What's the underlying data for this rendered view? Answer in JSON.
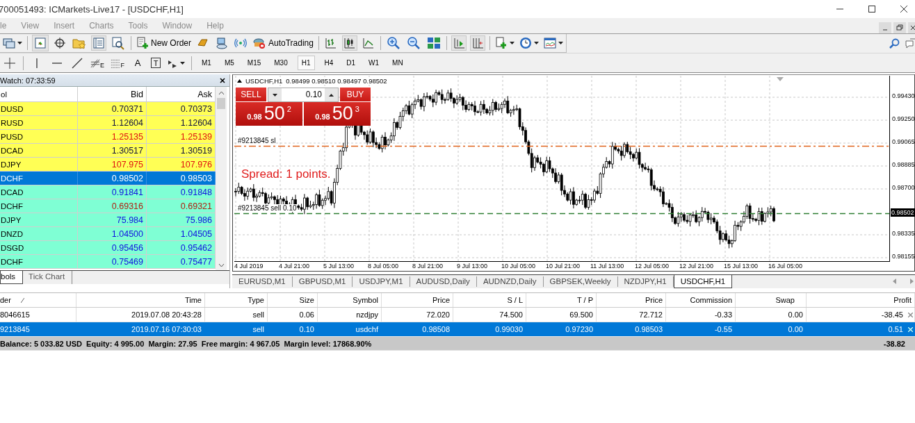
{
  "window": {
    "title": "700051493: ICMarkets-Live17 - [USDCHF,H1]"
  },
  "menu": [
    "le",
    "View",
    "Insert",
    "Charts",
    "Tools",
    "Window",
    "Help"
  ],
  "toolbar": {
    "new_order": "New Order",
    "autotrading": "AutoTrading"
  },
  "drawing_toolbar": {
    "fibo_labels": [
      "E",
      "F"
    ],
    "text_labels": [
      "A",
      "T"
    ]
  },
  "timeframes": [
    {
      "label": "M1",
      "selected": false
    },
    {
      "label": "M5",
      "selected": false
    },
    {
      "label": "M15",
      "selected": false
    },
    {
      "label": "M30",
      "selected": false
    },
    {
      "label": "H1",
      "selected": true
    },
    {
      "label": "H4",
      "selected": false
    },
    {
      "label": "D1",
      "selected": false
    },
    {
      "label": "W1",
      "selected": false
    },
    {
      "label": "MN",
      "selected": false
    }
  ],
  "market_watch": {
    "title": "Watch: 07:33:59",
    "columns": [
      "ol",
      "Bid",
      "Ask"
    ],
    "rows": [
      {
        "symbol": "DUSD",
        "bid": "0.70371",
        "ask": "0.70373",
        "kind": "primary",
        "color": "#101040",
        "selected": false
      },
      {
        "symbol": "RUSD",
        "bid": "1.12604",
        "ask": "1.12604",
        "kind": "primary",
        "color": "#101040",
        "selected": false
      },
      {
        "symbol": "PUSD",
        "bid": "1.25135",
        "ask": "1.25139",
        "kind": "primary",
        "color": "#e01010",
        "selected": false
      },
      {
        "symbol": "DCAD",
        "bid": "1.30517",
        "ask": "1.30519",
        "kind": "primary",
        "color": "#101040",
        "selected": false
      },
      {
        "symbol": "DJPY",
        "bid": "107.975",
        "ask": "107.976",
        "kind": "primary",
        "color": "#e01010",
        "selected": false
      },
      {
        "symbol": "DCHF",
        "bid": "0.98502",
        "ask": "0.98503",
        "selected": true
      },
      {
        "symbol": "DCAD",
        "bid": "0.91841",
        "ask": "0.91848",
        "kind": "secondary",
        "color": "#1010e0",
        "selected": false
      },
      {
        "symbol": "DCHF",
        "bid": "0.69316",
        "ask": "0.69321",
        "kind": "secondary",
        "color": "#b02010",
        "selected": false
      },
      {
        "symbol": "DJPY",
        "bid": "75.984",
        "ask": "75.986",
        "kind": "secondary",
        "color": "#1010e0",
        "selected": false
      },
      {
        "symbol": "DNZD",
        "bid": "1.04500",
        "ask": "1.04505",
        "kind": "secondary",
        "color": "#1010e0",
        "selected": false
      },
      {
        "symbol": "DSGD",
        "bid": "0.95456",
        "ask": "0.95462",
        "kind": "secondary",
        "color": "#1010e0",
        "selected": false
      },
      {
        "symbol": "DCHF",
        "bid": "0.75469",
        "ask": "0.75477",
        "kind": "secondary",
        "color": "#1010e0",
        "selected": false
      }
    ],
    "tabs": [
      {
        "label": "bols",
        "selected": true
      },
      {
        "label": "Tick Chart",
        "selected": false
      }
    ]
  },
  "chart": {
    "header": "USDCHF,H1",
    "ohlc": "0.98499 0.98510 0.98497 0.98502",
    "one_click": {
      "sell": "SELL",
      "buy": "BUY",
      "lot": "0.10",
      "sell_price": {
        "base": "0.98",
        "pips": "50",
        "point": "2"
      },
      "buy_price": {
        "base": "0.98",
        "pips": "50",
        "point": "3"
      }
    },
    "lines": [
      {
        "label": "#9213845 sl",
        "kind": "stop_loss"
      },
      {
        "label": "#9213845 sell 0.10",
        "kind": "order"
      }
    ],
    "spread": "Spread: 1 points.",
    "y_labels": [
      "0.99430",
      "0.99250",
      "0.99065",
      "0.98885",
      "0.98700",
      "0.98335",
      "0.98155"
    ],
    "current_price": "0.98502",
    "x_labels": [
      "4 Jul 2019",
      "4 Jul 21:00",
      "5 Jul 13:00",
      "8 Jul 05:00",
      "8 Jul 21:00",
      "9 Jul 13:00",
      "10 Jul 05:00",
      "10 Jul 21:00",
      "11 Jul 13:00",
      "12 Jul 05:00",
      "12 Jul 21:00",
      "15 Jul 13:00",
      "16 Jul 05:00"
    ]
  },
  "chart_tabs": [
    {
      "label": "EURUSD,M1",
      "selected": false
    },
    {
      "label": "GBPUSD,M1",
      "selected": false
    },
    {
      "label": "USDJPY,M1",
      "selected": false
    },
    {
      "label": "AUDUSD,Daily",
      "selected": false
    },
    {
      "label": "AUDNZD,Daily",
      "selected": false
    },
    {
      "label": "GBPSEK,Weekly",
      "selected": false
    },
    {
      "label": "NZDJPY,H1",
      "selected": false
    },
    {
      "label": "USDCHF,H1",
      "selected": true
    }
  ],
  "terminal": {
    "columns": [
      "der",
      "Time",
      "Type",
      "Size",
      "Symbol",
      "Price",
      "S / L",
      "T / P",
      "Price",
      "Commission",
      "Swap",
      "Profit"
    ],
    "rows": [
      {
        "cells": [
          "8046615",
          "2019.07.08 20:43:28",
          "sell",
          "0.06",
          "nzdjpy",
          "72.020",
          "74.500",
          "69.500",
          "72.712",
          "-0.33",
          "0.00",
          "-38.45"
        ],
        "selected": false
      },
      {
        "cells": [
          "9213845",
          "2019.07.16 07:30:03",
          "sell",
          "0.10",
          "usdchf",
          "0.98508",
          "0.99030",
          "0.97230",
          "0.98503",
          "-0.55",
          "0.00",
          "0.51"
        ],
        "selected": true
      }
    ],
    "summary": "Balance: 5 033.82 USD  Equity: 4 995.00  Margin: 27.95  Free margin: 4 967.05  Margin level: 17868.90%",
    "summary_profit": "-38.82"
  }
}
